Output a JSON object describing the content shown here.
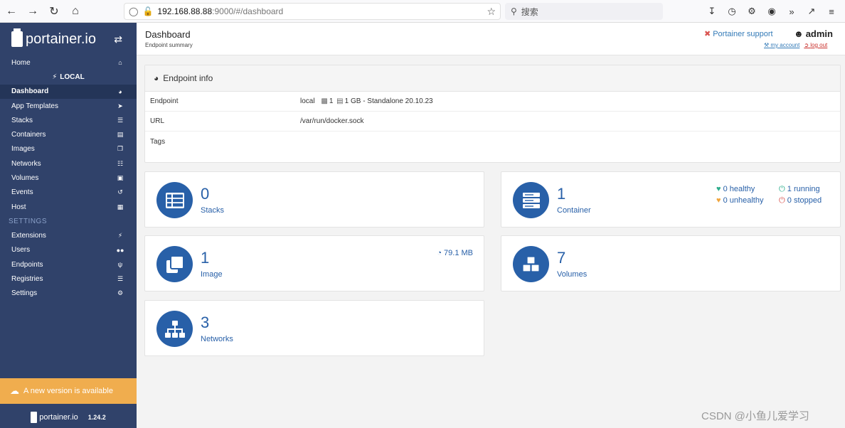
{
  "browser": {
    "url_host": "192.168.88.88",
    "url_path": ":9000/#/dashboard",
    "search_placeholder": "搜索"
  },
  "sidebar": {
    "logo": "portainer.io",
    "items_top": [
      {
        "label": "Home",
        "icon": "home-icon"
      }
    ],
    "endpoint_label": "LOCAL",
    "items_endpoint": [
      {
        "label": "Dashboard",
        "icon": "dashboard-icon",
        "active": true
      },
      {
        "label": "App Templates",
        "icon": "rocket-icon"
      },
      {
        "label": "Stacks",
        "icon": "list-icon"
      },
      {
        "label": "Containers",
        "icon": "server-icon"
      },
      {
        "label": "Images",
        "icon": "clone-icon"
      },
      {
        "label": "Networks",
        "icon": "sitemap-icon"
      },
      {
        "label": "Volumes",
        "icon": "cubes-icon"
      },
      {
        "label": "Events",
        "icon": "history-icon"
      },
      {
        "label": "Host",
        "icon": "th-icon"
      }
    ],
    "settings_heading": "SETTINGS",
    "items_settings": [
      {
        "label": "Extensions",
        "icon": "bolt-icon"
      },
      {
        "label": "Users",
        "icon": "users-icon"
      },
      {
        "label": "Endpoints",
        "icon": "plug-icon"
      },
      {
        "label": "Registries",
        "icon": "database-icon"
      },
      {
        "label": "Settings",
        "icon": "cogs-icon"
      }
    ],
    "update_banner": "A new version is available",
    "footer_logo": "portainer.io",
    "version": "1.24.2"
  },
  "header": {
    "title": "Dashboard",
    "subtitle": "Endpoint summary",
    "support": "Portainer support",
    "user": "admin",
    "my_account": "my account",
    "log_out": "log out"
  },
  "endpoint_info": {
    "title": "Endpoint info",
    "rows": [
      {
        "key": "Endpoint",
        "name": "local",
        "cpu": "1",
        "memory": "1 GB",
        "detail": "- Standalone 20.10.23"
      },
      {
        "key": "URL",
        "value": "/var/run/docker.sock"
      },
      {
        "key": "Tags",
        "value": ""
      }
    ]
  },
  "widgets": {
    "stacks": {
      "count": "0",
      "label": "Stacks"
    },
    "containers": {
      "count": "1",
      "label": "Container",
      "healthy": "0 healthy",
      "running": "1 running",
      "unhealthy": "0 unhealthy",
      "stopped": "0 stopped"
    },
    "images": {
      "count": "1",
      "label": "Image",
      "size": "79.1 MB"
    },
    "volumes": {
      "count": "7",
      "label": "Volumes"
    },
    "networks": {
      "count": "3",
      "label": "Networks"
    }
  },
  "watermark": "CSDN @小鱼儿爱学习",
  "colors": {
    "sidebar": "#30426a",
    "accent": "#2860a8",
    "banner": "#f0ad4e"
  }
}
